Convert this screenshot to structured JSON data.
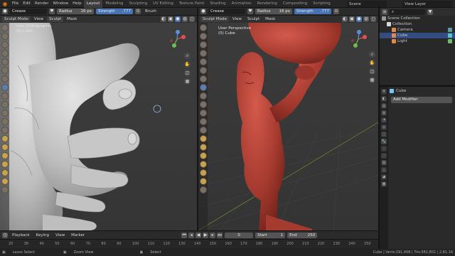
{
  "topbar": {
    "menu": [
      "File",
      "Edit",
      "Render",
      "Window",
      "Help"
    ],
    "workspaces": [
      "Layout",
      "Modeling",
      "Sculpting",
      "UV Editing",
      "Texture Paint",
      "Shading",
      "Animation",
      "Rendering",
      "Compositing",
      "Scripting"
    ],
    "active_workspace": "Layout",
    "scene": "Scene",
    "view_layer": "View Layer"
  },
  "left_toolbar": {
    "brush": "Crease",
    "radius_label": "Radius",
    "radius_value": "16 px",
    "strength_label": "Strength",
    "strength_value": ".777",
    "brush_menu": "Brush"
  },
  "right_toolbar": {
    "brush": "Crease",
    "radius_label": "Radius",
    "radius_value": "16 px",
    "strength_label": "Strength",
    "strength_value": ".777"
  },
  "left_header": {
    "mode": "Sculpt Mode",
    "menus": [
      "View",
      "Sculpt",
      "Mask"
    ]
  },
  "right_header": {
    "mode": "Sculpt Mode",
    "menus": [
      "View",
      "Sculpt",
      "Mask"
    ]
  },
  "left_viewport": {
    "view_name": "User Orthographic",
    "object": "(0) Cube"
  },
  "right_viewport": {
    "view_name": "User Perspective",
    "object": "(0) Cube"
  },
  "outliner": {
    "title": "Scene Collection",
    "rows": [
      "Collection",
      "Camera",
      "Cube",
      "Light"
    ]
  },
  "properties": {
    "object_name": "Cube",
    "add_modifier": "Add Modifier"
  },
  "timeline": {
    "menus": [
      "Playback",
      "Keying",
      "View",
      "Marker"
    ],
    "current_frame": "0",
    "start_label": "Start",
    "start_value": "1",
    "end_label": "End",
    "end_value": "250"
  },
  "ruler": {
    "ticks": [
      "20",
      "30",
      "40",
      "50",
      "60",
      "70",
      "80",
      "90",
      "100",
      "110",
      "120",
      "130",
      "140",
      "150",
      "160",
      "170",
      "180",
      "190",
      "200",
      "210",
      "220",
      "230",
      "240",
      "250"
    ]
  },
  "statusbar": {
    "lasso": "Lasso Select",
    "zoom": "Zoom View",
    "select": "Select",
    "stats": "Cube | Verts:291,408 | Tris:582,802 | 2.81.16"
  },
  "colors": {
    "accent_blue": "#4772b3",
    "sculpt_red": "#b8453a",
    "clay_grey": "#c9c9c9"
  }
}
